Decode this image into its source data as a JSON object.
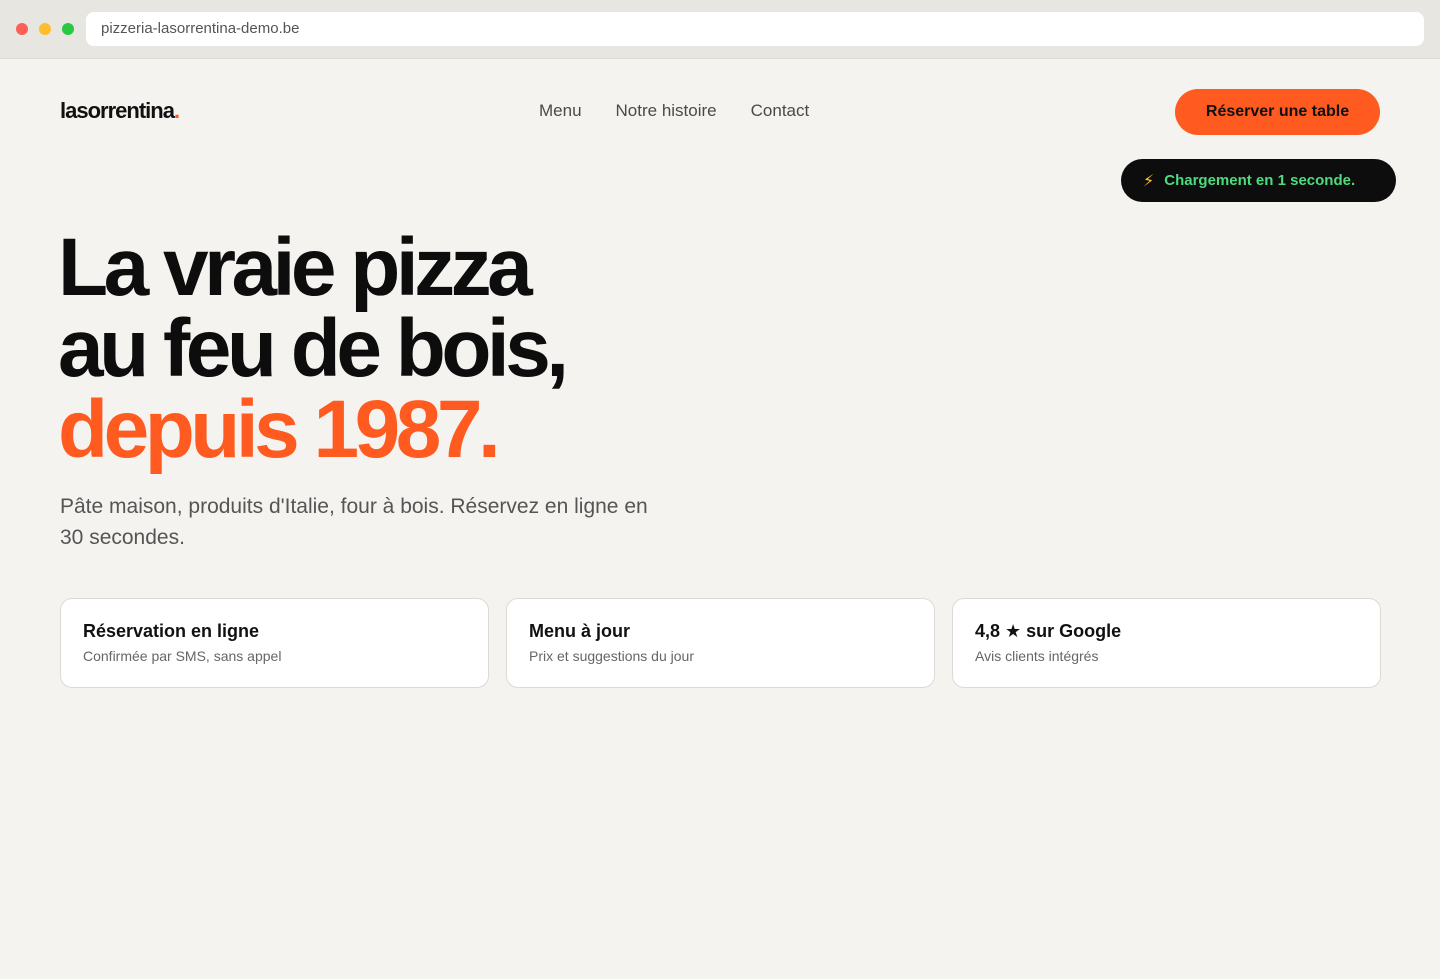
{
  "browser": {
    "url": "pizzeria-lasorrentina-demo.be"
  },
  "header": {
    "logo_text": "lasorrentina",
    "logo_dot": ".",
    "nav": [
      {
        "label": "Menu"
      },
      {
        "label": "Notre histoire"
      },
      {
        "label": "Contact"
      }
    ],
    "cta_label": "Réserver une table"
  },
  "badge": {
    "icon": "lightning-icon",
    "text": "Chargement en 1 seconde."
  },
  "hero": {
    "line1": "La vraie pizza",
    "line2": "au feu de bois,",
    "line3": "depuis 1987.",
    "subtitle": "Pâte maison, produits d'Italie, four à bois. Réservez en ligne en 30 secondes."
  },
  "features": [
    {
      "title": "Réservation en ligne",
      "description": "Confirmée par SMS, sans appel"
    },
    {
      "title": "Menu à jour",
      "description": "Prix et suggestions du jour"
    },
    {
      "title": "4,8 ★ sur Google",
      "description": "Avis clients intégrés"
    }
  ],
  "colors": {
    "accent": "#ff5a1f",
    "background": "#f4f3ef",
    "badge_bg": "#0d0d0d",
    "badge_text": "#4ddb7f"
  }
}
